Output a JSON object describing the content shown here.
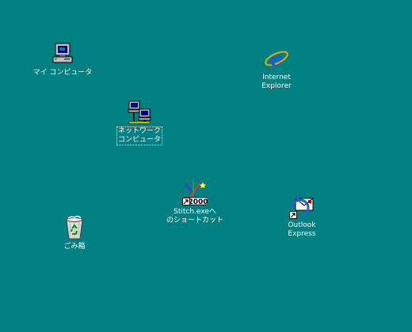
{
  "desktop": {
    "background_color": "#008080",
    "icons": [
      {
        "id": "my-computer",
        "lines": [
          "マイ コンピュータ"
        ],
        "icon": "computer-icon"
      },
      {
        "id": "internet-explorer",
        "lines": [
          "Internet",
          "Explorer"
        ],
        "icon": "internet-explorer-icon"
      },
      {
        "id": "network",
        "lines": [
          "ネットワーク",
          "コンピュータ"
        ],
        "icon": "network-computers-icon",
        "selected": true
      },
      {
        "id": "stitch-shortcut",
        "lines": [
          "Stitch.exeへ",
          "のショートカット"
        ],
        "icon": "stitch-app-icon",
        "shortcut": true
      },
      {
        "id": "outlook-express",
        "lines": [
          "Outlook",
          "Express"
        ],
        "icon": "outlook-express-icon",
        "shortcut": true
      },
      {
        "id": "recycle-bin",
        "lines": [
          "ごみ箱"
        ],
        "icon": "recycle-bin-icon"
      }
    ],
    "stitch_icon_text": "2000"
  }
}
